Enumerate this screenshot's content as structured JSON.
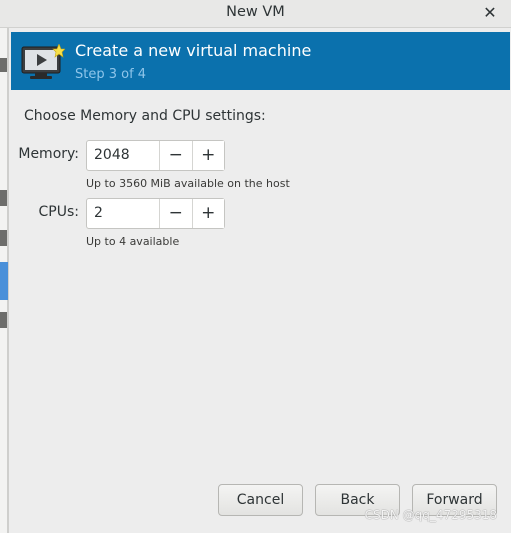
{
  "window": {
    "title": "New VM",
    "close_glyph": "✕"
  },
  "banner": {
    "title": "Create a new virtual machine",
    "subtitle": "Step 3 of 4",
    "icon": "monitor-new-vm-icon",
    "background": "#0b71ad"
  },
  "content": {
    "prompt": "Choose Memory and CPU settings:",
    "memory": {
      "label": "Memory:",
      "value": "2048",
      "hint": "Up to 3560 MiB available on the host",
      "decrement": "−",
      "increment": "+"
    },
    "cpus": {
      "label": "CPUs:",
      "value": "2",
      "hint": "Up to 4 available",
      "decrement": "−",
      "increment": "+"
    }
  },
  "buttons": {
    "cancel": "Cancel",
    "back": "Back",
    "forward": "Forward"
  },
  "watermark": "CSDN @qq_47295318"
}
